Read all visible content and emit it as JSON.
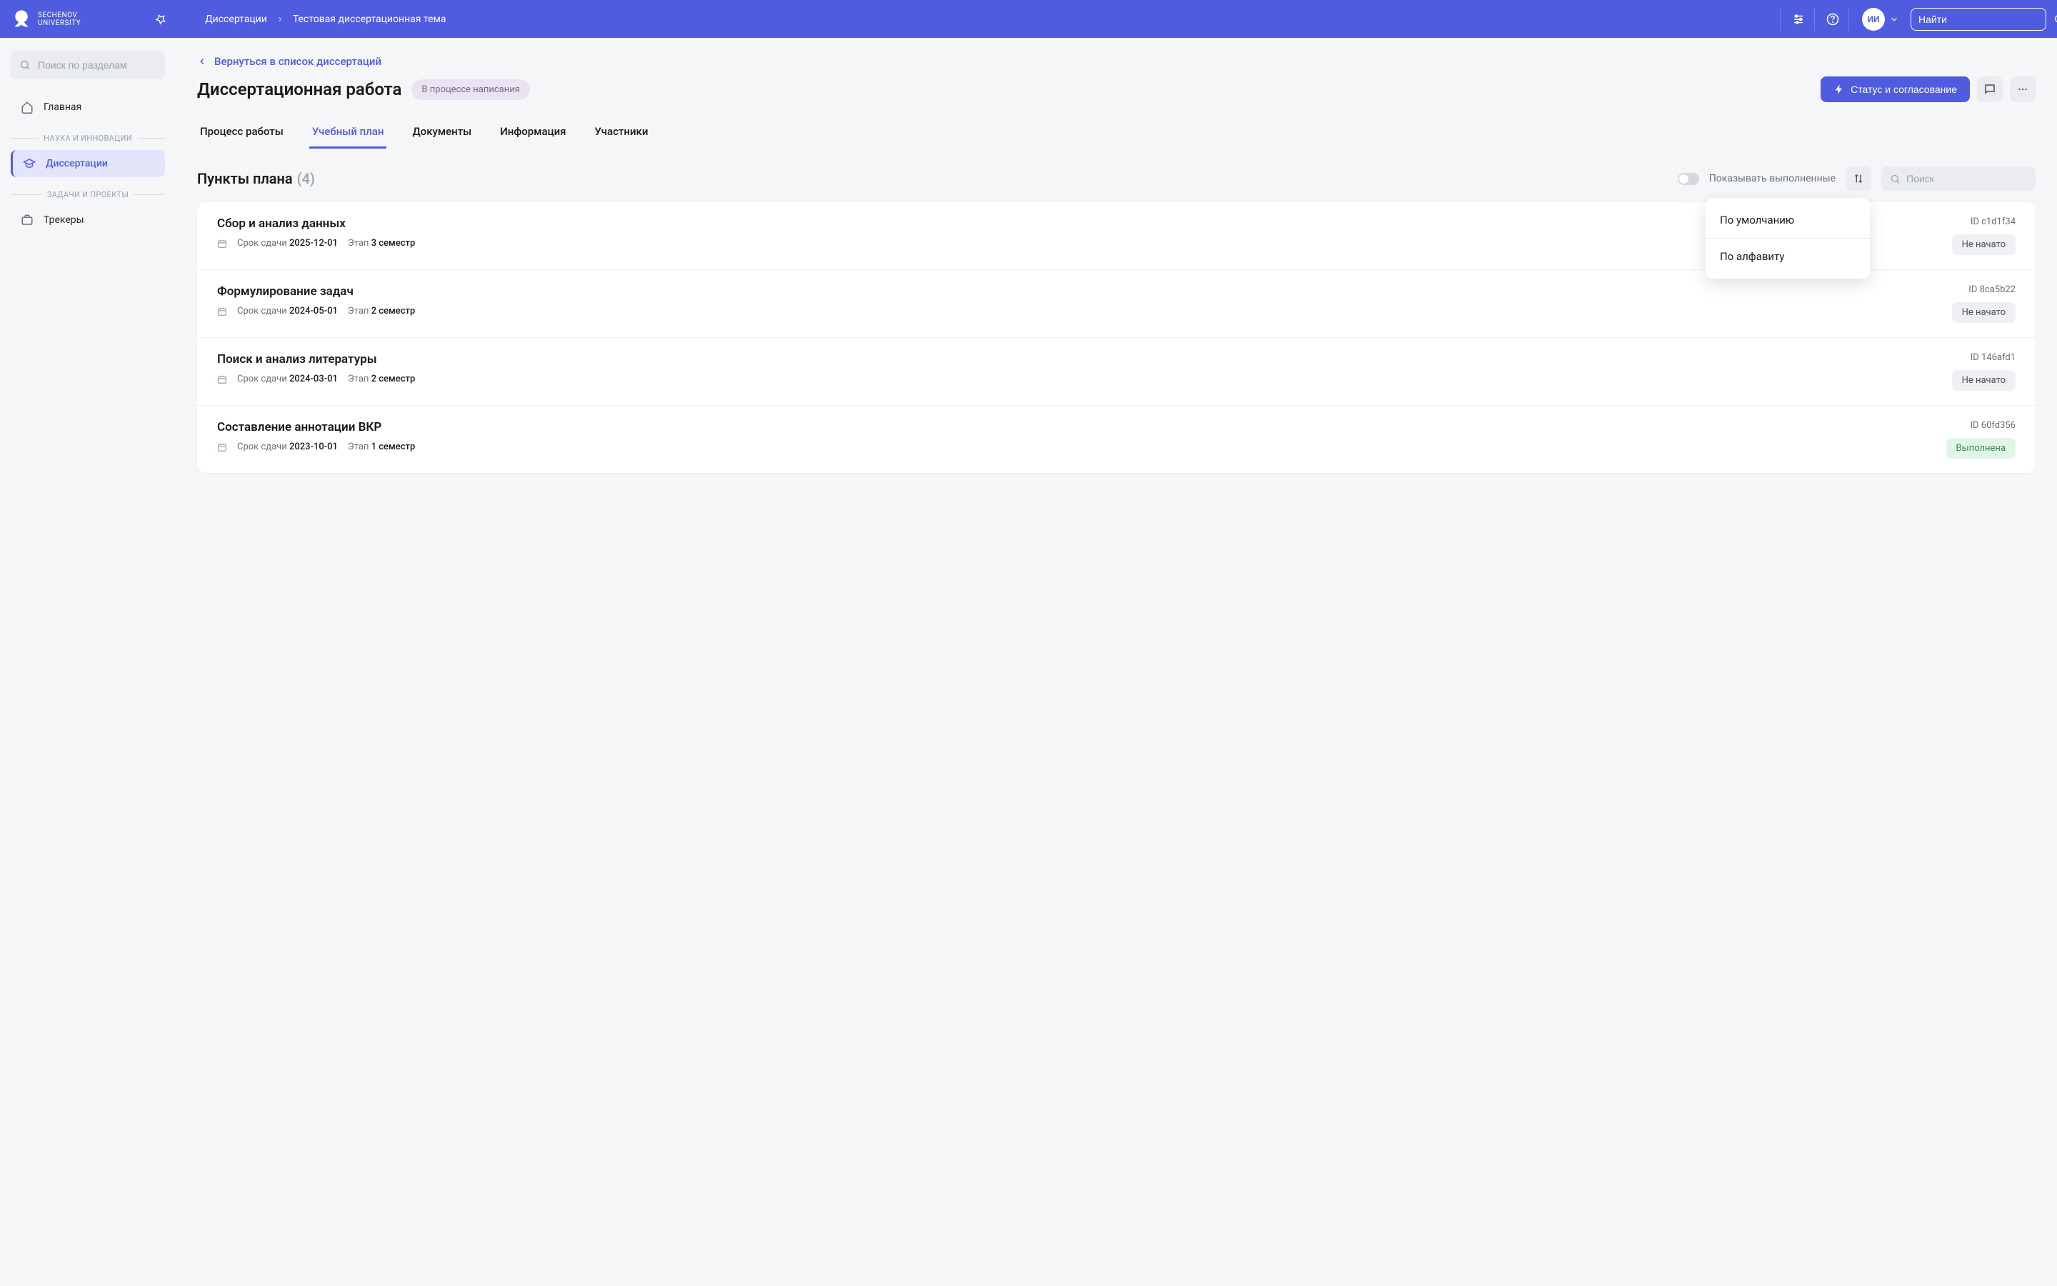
{
  "topbar": {
    "logo_line1": "SECHENOV",
    "logo_line2": "UNIVERSITY",
    "breadcrumb": [
      "Диссертации",
      "Тестовая диссертационная тема"
    ],
    "avatar_initials": "ИИ",
    "search_placeholder": "Найти"
  },
  "sidebar": {
    "search_placeholder": "Поиск по разделам",
    "sections": [
      {
        "label": "НАУКА И ИННОВАЦИИ"
      },
      {
        "label": "ЗАДАЧИ И ПРОЕКТЫ"
      }
    ],
    "items": [
      {
        "label": "Главная",
        "icon": "home"
      },
      {
        "label": "Диссертации",
        "icon": "grad-cap",
        "active": true
      },
      {
        "label": "Трекеры",
        "icon": "briefcase"
      }
    ]
  },
  "page": {
    "back_label": "Вернуться в список диссертаций",
    "title": "Диссертационная работа",
    "status_pill": "В процессе написания",
    "status_button": "Статус и согласование"
  },
  "tabs": [
    "Процесс работы",
    "Учебный план",
    "Документы",
    "Информация",
    "Участники"
  ],
  "active_tab_index": 1,
  "plan": {
    "title": "Пункты плана",
    "count": "(4)",
    "toggle_label": "Показывать выполненные",
    "search_placeholder": "Поиск",
    "sort_options": [
      "По умолчанию",
      "По алфавиту"
    ],
    "meta_labels": {
      "deadline": "Срок сдачи",
      "stage": "Этап",
      "id_prefix": "ID"
    },
    "items": [
      {
        "title": "Сбор и анализ данных",
        "deadline": "2025-12-01",
        "stage": "3 семестр",
        "id": "c1d1f34",
        "status": "Не начато",
        "status_type": "notstarted"
      },
      {
        "title": "Формулирование задач",
        "deadline": "2024-05-01",
        "stage": "2 семестр",
        "id": "8ca5b22",
        "status": "Не начато",
        "status_type": "notstarted"
      },
      {
        "title": "Поиск и анализ литературы",
        "deadline": "2024-03-01",
        "stage": "2 семестр",
        "id": "146afd1",
        "status": "Не начато",
        "status_type": "notstarted"
      },
      {
        "title": "Составление аннотации ВКР",
        "deadline": "2023-10-01",
        "stage": "1 семестр",
        "id": "60fd356",
        "status": "Выполнена",
        "status_type": "done"
      }
    ]
  }
}
